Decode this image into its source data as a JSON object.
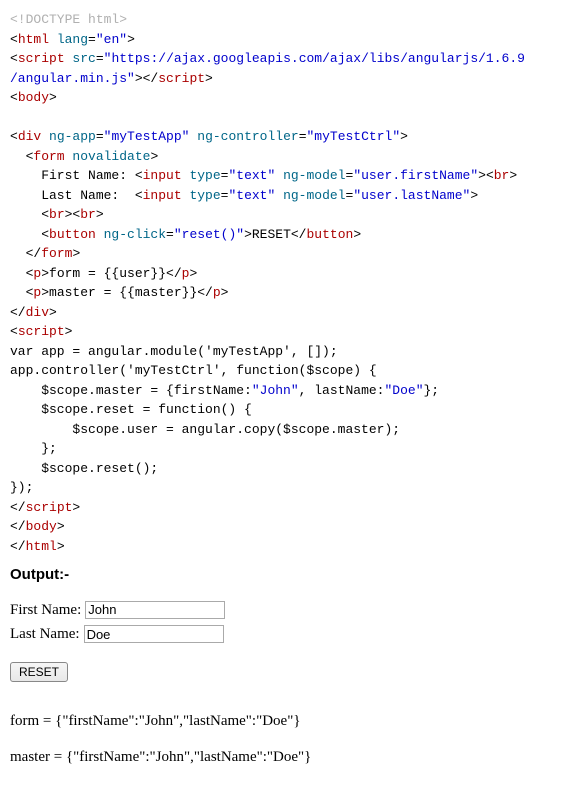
{
  "code": {
    "line1_doctype": "<!DOCTYPE html>",
    "line2_a": "<",
    "line2_b": "html",
    "line2_c": " lang",
    "line2_d": "=",
    "line2_e": "\"en\"",
    "line2_f": ">",
    "line3_a": "<",
    "line3_b": "script",
    "line3_c": " src",
    "line3_d": "=",
    "line3_e": "\"https://ajax.googleapis.com/ajax/libs/angularjs/1.6.9",
    "line4_a": "/angular.min.js\"",
    "line4_b": "></",
    "line4_c": "script",
    "line4_d": ">",
    "line5_a": "<",
    "line5_b": "body",
    "line5_c": ">",
    "line7_a": "<",
    "line7_b": "div",
    "line7_c": " ng-app",
    "line7_d": "=",
    "line7_e": "\"myTestApp\"",
    "line7_f": " ng-controller",
    "line7_g": "=",
    "line7_h": "\"myTestCtrl\"",
    "line7_i": ">",
    "line8_a": "  <",
    "line8_b": "form",
    "line8_c": " novalidate",
    "line8_d": ">",
    "line9_a": "    First Name: <",
    "line9_b": "input",
    "line9_c": " type",
    "line9_d": "=",
    "line9_e": "\"text\"",
    "line9_f": " ng-model",
    "line9_g": "=",
    "line9_h": "\"user.firstName\"",
    "line9_i": "><",
    "line9_j": "br",
    "line9_k": ">",
    "line10_a": "    Last Name:  <",
    "line10_b": "input",
    "line10_c": " type",
    "line10_d": "=",
    "line10_e": "\"text\"",
    "line10_f": " ng-model",
    "line10_g": "=",
    "line10_h": "\"user.lastName\"",
    "line10_i": ">",
    "line11_a": "    <",
    "line11_b": "br",
    "line11_c": "><",
    "line11_d": "br",
    "line11_e": ">",
    "line12_a": "    <",
    "line12_b": "button",
    "line12_c": " ng-click",
    "line12_d": "=",
    "line12_e": "\"reset()\"",
    "line12_f": ">RESET</",
    "line12_g": "button",
    "line12_h": ">",
    "line13_a": "  </",
    "line13_b": "form",
    "line13_c": ">",
    "line14_a": "  <",
    "line14_b": "p",
    "line14_c": ">form = {{user}}</",
    "line14_d": "p",
    "line14_e": ">",
    "line15_a": "  <",
    "line15_b": "p",
    "line15_c": ">master = {{master}}</",
    "line15_d": "p",
    "line15_e": ">",
    "line16_a": "</",
    "line16_b": "div",
    "line16_c": ">",
    "line17_a": "<",
    "line17_b": "script",
    "line17_c": ">",
    "line18": "var app = angular.module('myTestApp', []);",
    "line19": "app.controller('myTestCtrl', function($scope) {",
    "line20_a": "    $scope.master = {firstName:",
    "line20_b": "\"John\"",
    "line20_c": ", lastName:",
    "line20_d": "\"Doe\"",
    "line20_e": "};",
    "line21": "    $scope.reset = function() {",
    "line22": "        $scope.user = angular.copy($scope.master);",
    "line23": "    };",
    "line24": "    $scope.reset();",
    "line25": "});",
    "line26_a": "</",
    "line26_b": "script",
    "line26_c": ">",
    "line27_a": "</",
    "line27_b": "body",
    "line27_c": ">",
    "line28_a": "</",
    "line28_b": "html",
    "line28_c": ">"
  },
  "output": {
    "heading": "Output:-",
    "first_name_label": "First Name:",
    "first_name_value": "John",
    "last_name_label": "Last Name:",
    "last_name_value": "Doe",
    "reset_button": "RESET",
    "form_line": "form = {\"firstName\":\"John\",\"lastName\":\"Doe\"}",
    "master_line": "master = {\"firstName\":\"John\",\"lastName\":\"Doe\"}"
  }
}
